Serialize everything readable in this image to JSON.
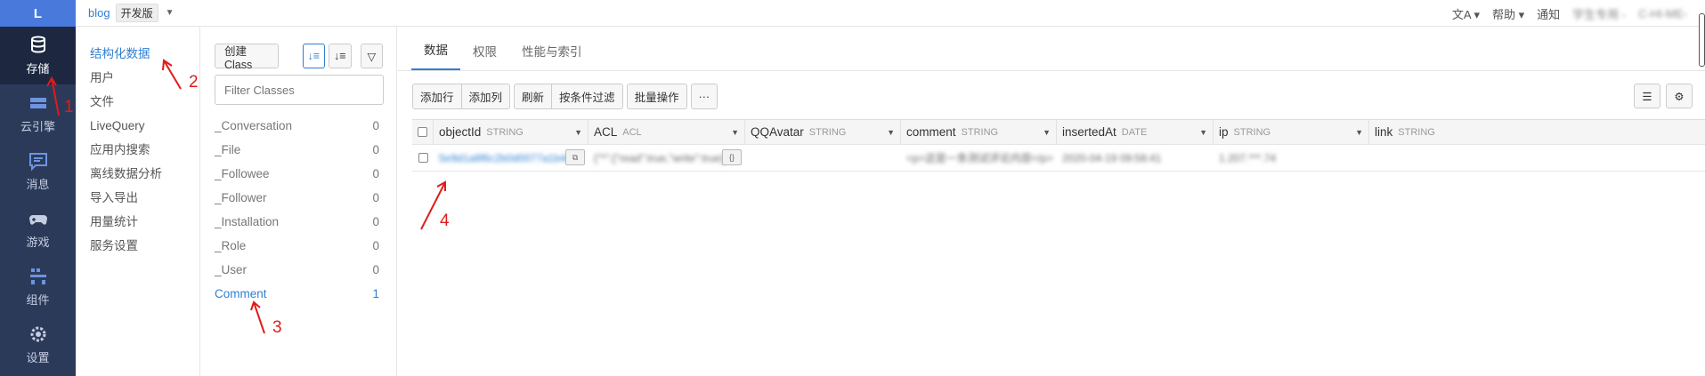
{
  "rail": {
    "logo": "L",
    "items": [
      {
        "label": "存储",
        "icon": "database-icon",
        "active": true
      },
      {
        "label": "云引擎",
        "icon": "server-icon"
      },
      {
        "label": "消息",
        "icon": "message-icon"
      },
      {
        "label": "游戏",
        "icon": "gamepad-icon"
      },
      {
        "label": "组件",
        "icon": "puzzle-icon"
      },
      {
        "label": "设置",
        "icon": "gear-icon"
      }
    ]
  },
  "topbar": {
    "app_name": "blog",
    "env": "开发版",
    "right": {
      "help": "帮助",
      "notify": "通知",
      "org": "学生专用 -",
      "user": "C-HI-ME-"
    }
  },
  "menu2": {
    "items": [
      "结构化数据",
      "用户",
      "文件",
      "LiveQuery",
      "应用内搜索",
      "离线数据分析",
      "导入导出",
      "用量统计",
      "服务设置"
    ]
  },
  "classes": {
    "create_label": "创建 Class",
    "filter_placeholder": "Filter Classes",
    "list": [
      {
        "name": "_Conversation",
        "count": "0"
      },
      {
        "name": "_File",
        "count": "0"
      },
      {
        "name": "_Followee",
        "count": "0"
      },
      {
        "name": "_Follower",
        "count": "0"
      },
      {
        "name": "_Installation",
        "count": "0"
      },
      {
        "name": "_Role",
        "count": "0"
      },
      {
        "name": "_User",
        "count": "0"
      },
      {
        "name": "Comment",
        "count": "1",
        "active": true
      }
    ]
  },
  "main": {
    "tabs": [
      "数据",
      "权限",
      "性能与索引"
    ],
    "actions": {
      "add_row": "添加行",
      "add_col": "添加列",
      "refresh": "刷新",
      "filter": "按条件过滤",
      "batch": "批量操作",
      "more": "···"
    },
    "columns": [
      {
        "name": "objectId",
        "type": "STRING"
      },
      {
        "name": "ACL",
        "type": "ACL"
      },
      {
        "name": "QQAvatar",
        "type": "STRING"
      },
      {
        "name": "comment",
        "type": "STRING"
      },
      {
        "name": "insertedAt",
        "type": "DATE"
      },
      {
        "name": "ip",
        "type": "STRING"
      },
      {
        "name": "link",
        "type": "STRING"
      }
    ],
    "row": {
      "objectId": "5e9d1a8f6c2b0d0077a1b4e2",
      "acl": "{\"*\":{\"read\":true,\"write\":true}}",
      "qqavatar": "",
      "comment": "<p>这是一条测试评论内容</p>",
      "insertedAt": "2020-04-19 09:58:41",
      "ip": "1.207.***.74",
      "link": ""
    }
  },
  "annotations": [
    "1",
    "2",
    "3",
    "4"
  ]
}
